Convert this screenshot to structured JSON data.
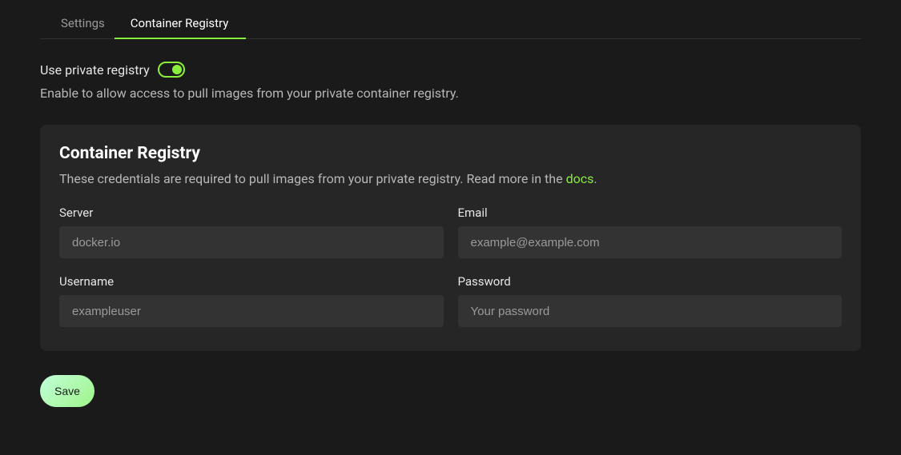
{
  "tabs": {
    "settings": "Settings",
    "container_registry": "Container Registry"
  },
  "toggle": {
    "label": "Use private registry",
    "state": "on"
  },
  "description": "Enable to allow access to pull images from your private container registry.",
  "card": {
    "title": "Container Registry",
    "subtitle_pre": "These credentials are required to pull images from your private registry. Read more in the ",
    "docs_link": "docs",
    "subtitle_post": "."
  },
  "fields": {
    "server": {
      "label": "Server",
      "placeholder": "docker.io",
      "value": ""
    },
    "email": {
      "label": "Email",
      "placeholder": "example@example.com",
      "value": ""
    },
    "username": {
      "label": "Username",
      "placeholder": "exampleuser",
      "value": ""
    },
    "password": {
      "label": "Password",
      "placeholder": "Your password",
      "value": ""
    }
  },
  "buttons": {
    "save": "Save"
  },
  "colors": {
    "accent": "#8aee3d",
    "bg": "#1a1a1a",
    "card": "#262626",
    "input": "#333333"
  }
}
